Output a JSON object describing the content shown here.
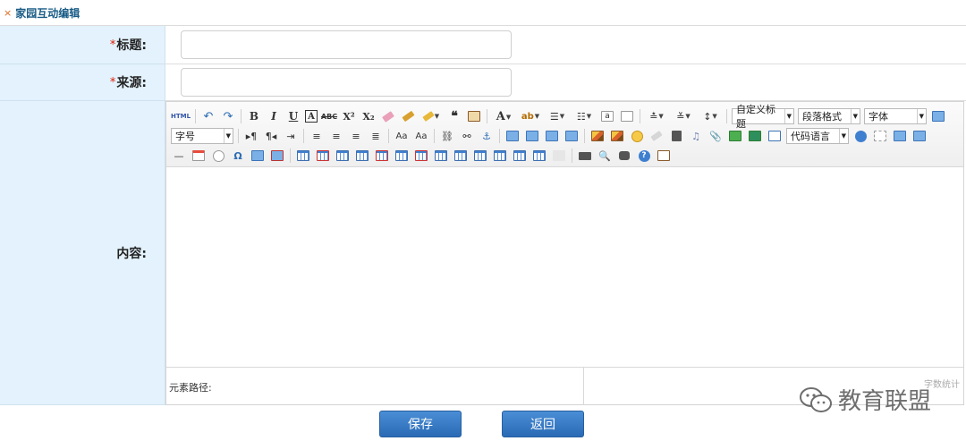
{
  "header": {
    "title": "家园互动编辑",
    "marker": "×"
  },
  "form": {
    "title_label": "标题:",
    "source_label": "来源:",
    "content_label": "内容:",
    "required_mark": "*",
    "title_value": "",
    "source_value": ""
  },
  "toolbar": {
    "html_label": "HTML",
    "bold": "B",
    "italic": "I",
    "underline": "U",
    "font_border": "A",
    "strike": "ABC",
    "sup": "X²",
    "sub": "X₂",
    "font_color": "A",
    "quote": "❝",
    "custom_heading": "自定义标题",
    "paragraph_format": "段落格式",
    "font_family": "字体",
    "font_size": "字号",
    "code_language": "代码语言",
    "special_char": "Ω"
  },
  "editor": {
    "status_path": "元素路径:",
    "word_count": "字数统计"
  },
  "footer": {
    "save": "保存",
    "back": "返回"
  },
  "watermark": {
    "text": "教育联盟"
  }
}
